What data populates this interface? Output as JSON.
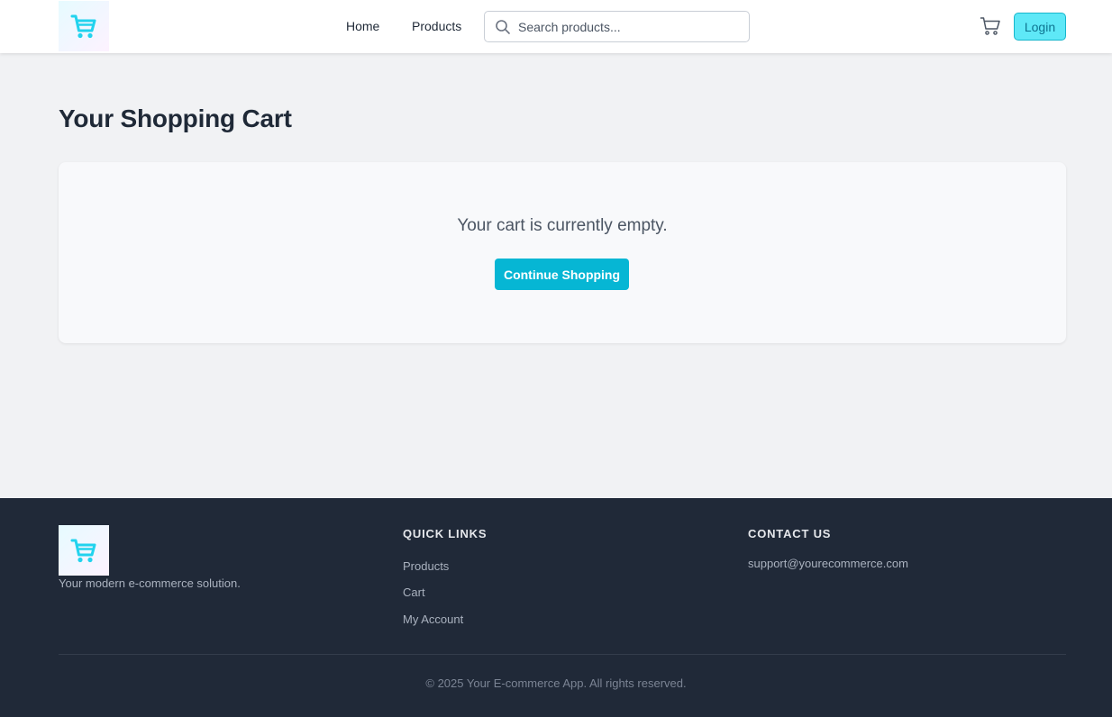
{
  "header": {
    "logo_icon": "shopping-cart-icon",
    "nav": {
      "home": "Home",
      "products": "Products"
    },
    "search": {
      "placeholder": "Search products...",
      "icon": "search-icon"
    },
    "cart_icon": "cart-icon",
    "login_label": "Login"
  },
  "main": {
    "title": "Your Shopping Cart",
    "empty_message": "Your cart is currently empty.",
    "continue_label": "Continue Shopping"
  },
  "footer": {
    "tagline": "Your modern e-commerce solution.",
    "quick_links": {
      "heading": "QUICK LINKS",
      "items": [
        "Products",
        "Cart",
        "My Account"
      ]
    },
    "contact": {
      "heading": "CONTACT US",
      "email": "support@yourecommerce.com"
    },
    "copyright": "© 2025 Your E-commerce App. All rights reserved."
  },
  "colors": {
    "accent": "#06b6d4",
    "login_bg": "#5ee8f7",
    "footer_bg": "#202938",
    "page_bg": "#f1f2f4",
    "logo_cart": "#22d3ee"
  }
}
